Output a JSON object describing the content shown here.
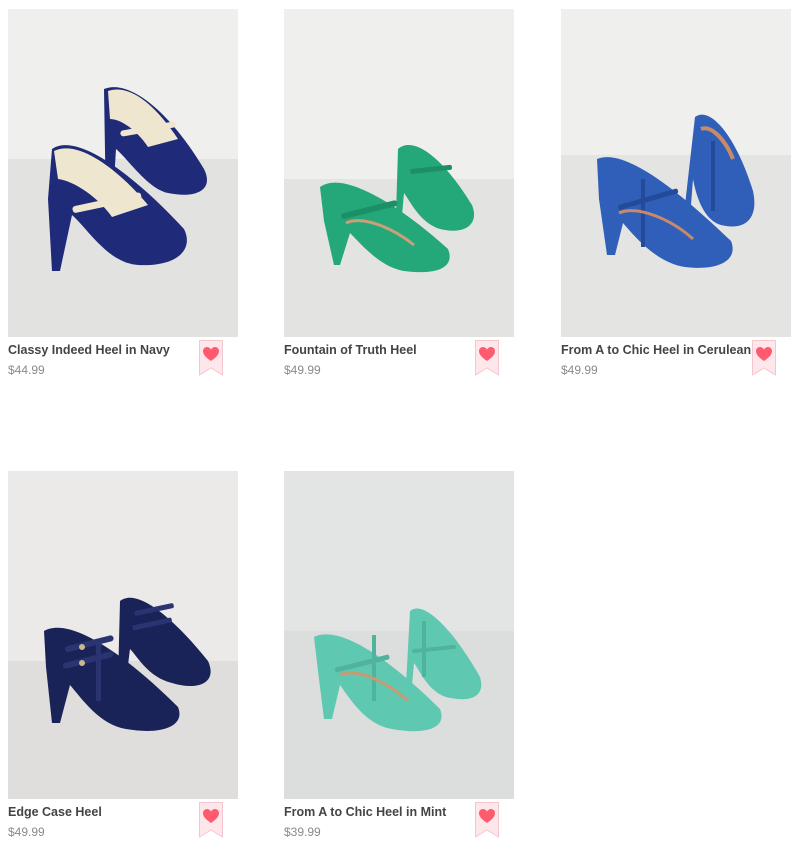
{
  "products": [
    {
      "name": "Classy Indeed Heel in Navy",
      "price": "$44.99",
      "image": "navy-cream-mary-jane-heels",
      "colors": {
        "main": "#1f2a78",
        "accent": "#efe6cf",
        "bg": "#eeeeec"
      },
      "favorite_icon": "heart-icon"
    },
    {
      "name": "Fountain of Truth Heel",
      "price": "$49.99",
      "image": "green-mary-jane-heels",
      "colors": {
        "main": "#24a87a",
        "accent": "#24a87a",
        "bg": "#eeeeec"
      },
      "favorite_icon": "heart-icon"
    },
    {
      "name": "From A to Chic Heel in Cerulean",
      "price": "$49.99",
      "image": "cerulean-t-strap-heels",
      "colors": {
        "main": "#2f5fb8",
        "accent": "#2f5fb8",
        "bg": "#efefed"
      },
      "favorite_icon": "heart-icon"
    },
    {
      "name": "Edge Case Heel",
      "price": "$49.99",
      "image": "navy-double-strap-t-bar-heels",
      "colors": {
        "main": "#1a2358",
        "accent": "#1a2358",
        "bg": "#eceae8"
      },
      "favorite_icon": "heart-icon"
    },
    {
      "name": "From A to Chic Heel in Mint",
      "price": "$39.99",
      "image": "mint-t-strap-heels",
      "colors": {
        "main": "#5fc8b0",
        "accent": "#5fc8b0",
        "bg": "#e3e4e4"
      },
      "favorite_icon": "heart-icon"
    }
  ],
  "favorite_colors": {
    "heart": "#ff5a6e",
    "ribbon": "#fde7ea",
    "ribbon_border": "#f6c6ce"
  }
}
